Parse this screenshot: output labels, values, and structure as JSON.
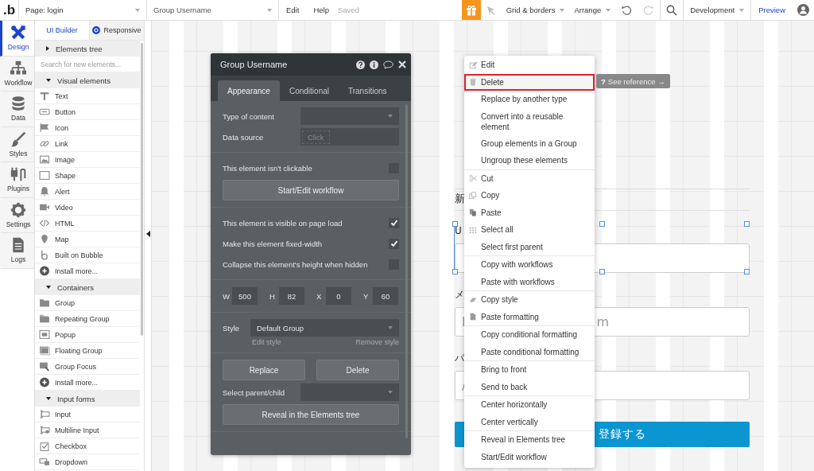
{
  "top_bar": {
    "logo": ".b",
    "page_select": "Page: login",
    "element_select": "Group Username",
    "menu": [
      "Edit",
      "Help"
    ],
    "save_status": "Saved",
    "grid_menu": "Grid & borders",
    "arrange_menu": "Arrange",
    "environment": "Development",
    "preview": "Preview"
  },
  "rail": [
    {
      "label": "Design",
      "selected": true
    },
    {
      "label": "Workflow",
      "selected": false
    },
    {
      "label": "Data",
      "selected": false
    },
    {
      "label": "Styles",
      "selected": false
    },
    {
      "label": "Plugins",
      "selected": false
    },
    {
      "label": "Settings",
      "selected": false
    },
    {
      "label": "Logs",
      "selected": false
    }
  ],
  "palette": {
    "tabs": [
      {
        "label": "UI Builder",
        "selected": true
      },
      {
        "label": "Responsive",
        "selected": false
      }
    ],
    "elements_tree": {
      "label": "Elements tree",
      "expanded": false
    },
    "search": {
      "placeholder": "Search for new elements..."
    },
    "groups": [
      {
        "label": "Visual elements",
        "expanded": true,
        "items": [
          "Text",
          "Button",
          "Icon",
          "Link",
          "Image",
          "Shape",
          "Alert",
          "Video",
          "HTML",
          "Map",
          "Built on Bubble",
          "Install more..."
        ]
      },
      {
        "label": "Containers",
        "expanded": true,
        "items": [
          "Group",
          "Repeating Group",
          "Popup",
          "Floating Group",
          "Group Focus",
          "Install more..."
        ]
      },
      {
        "label": "Input forms",
        "expanded": true,
        "items": [
          "Input",
          "Multiline Input",
          "Checkbox",
          "Dropdown"
        ]
      }
    ]
  },
  "editor": {
    "title": "Group Username",
    "tabs": [
      {
        "label": "Appearance",
        "selected": true
      },
      {
        "label": "Conditional",
        "selected": false
      },
      {
        "label": "Transitions",
        "selected": false
      }
    ],
    "sections": [
      [
        {
          "kind": "select",
          "label": "Type of content"
        },
        {
          "kind": "field",
          "label": "Data source",
          "placeholder": "Click"
        }
      ],
      [
        {
          "kind": "check",
          "label": "This element isn't clickable",
          "checked": false
        },
        {
          "kind": "button",
          "label": "Start/Edit workflow"
        }
      ],
      [
        {
          "kind": "check",
          "label": "This element is visible on page load",
          "checked": true
        },
        {
          "kind": "check",
          "label": "Make this element fixed-width",
          "checked": true
        },
        {
          "kind": "check",
          "label": "Collapse this element's height when hidden",
          "checked": false
        }
      ],
      [
        {
          "kind": "dims",
          "items": [
            {
              "label": "W",
              "value": "500"
            },
            {
              "label": "H",
              "value": "82"
            },
            {
              "label": "X",
              "value": "0"
            },
            {
              "label": "Y",
              "value": "60"
            }
          ]
        }
      ],
      [
        {
          "kind": "style",
          "label": "Style",
          "value": "Default Group",
          "links": [
            "Edit style",
            "Remove style"
          ]
        }
      ],
      [
        {
          "kind": "buttons",
          "items": [
            "Replace",
            "Delete"
          ]
        },
        {
          "kind": "select",
          "label": "Select parent/child"
        },
        {
          "kind": "button",
          "label": "Reveal in the Elements tree"
        }
      ]
    ]
  },
  "canvas": {
    "heading": "新",
    "fields": [
      {
        "label": "U"
      },
      {
        "label": "メ",
        "visible_start": "l",
        "visible_end": "m"
      },
      {
        "label": "パ",
        "visible_start": "/"
      }
    ],
    "submit": "登録する"
  },
  "context_menu": {
    "groups": [
      [
        {
          "label": "Edit",
          "highlighted": false
        },
        {
          "label": "Delete",
          "highlighted": true
        },
        {
          "label": "Replace by another type",
          "highlighted": false
        },
        {
          "label": "Convert into a reusable element",
          "highlighted": false
        },
        {
          "label": "Group elements in a Group",
          "highlighted": false
        },
        {
          "label": "Ungroup these elements",
          "highlighted": false
        }
      ],
      [
        {
          "label": "Cut",
          "highlighted": false
        },
        {
          "label": "Copy",
          "highlighted": false
        },
        {
          "label": "Paste",
          "highlighted": false
        },
        {
          "label": "Select all",
          "highlighted": false
        },
        {
          "label": "Select first parent",
          "highlighted": false
        }
      ],
      [
        {
          "label": "Copy with workflows",
          "highlighted": false
        },
        {
          "label": "Paste with workflows",
          "highlighted": false
        }
      ],
      [
        {
          "label": "Copy style",
          "highlighted": false
        },
        {
          "label": "Paste formatting",
          "highlighted": false
        }
      ],
      [
        {
          "label": "Copy conditional formatting",
          "highlighted": false
        },
        {
          "label": "Paste conditional formatting",
          "highlighted": false
        }
      ],
      [
        {
          "label": "Bring to front",
          "highlighted": false
        },
        {
          "label": "Send to back",
          "highlighted": false
        }
      ],
      [
        {
          "label": "Center horizontally",
          "highlighted": false
        },
        {
          "label": "Center vertically",
          "highlighted": false
        }
      ],
      [
        {
          "label": "Reveal in Elements tree",
          "highlighted": false
        },
        {
          "label": "Start/Edit workflow",
          "highlighted": false
        }
      ]
    ],
    "tooltip": {
      "icon": "?",
      "label": "See reference →"
    }
  }
}
